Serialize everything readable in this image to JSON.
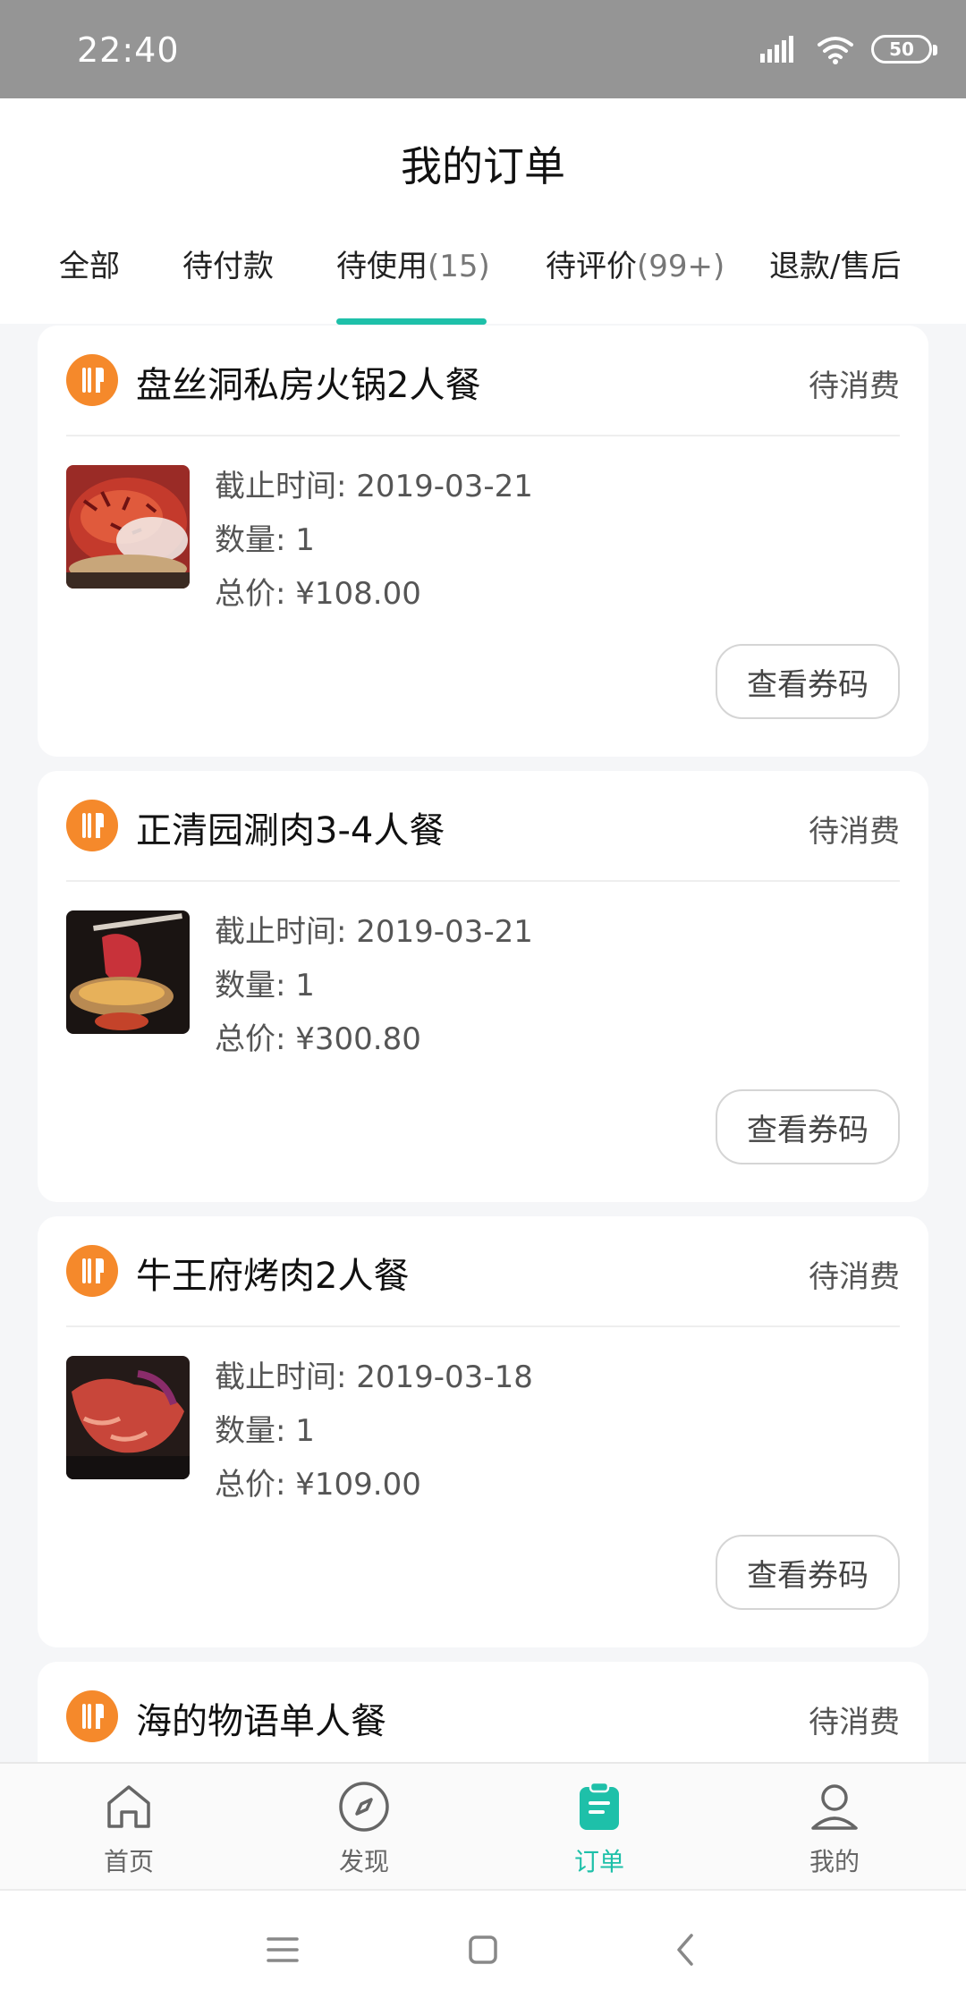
{
  "status_bar": {
    "time": "22:40",
    "battery": "50"
  },
  "header": {
    "title": "我的订单"
  },
  "tabs": [
    {
      "label": "全部",
      "count": ""
    },
    {
      "label": "待付款",
      "count": ""
    },
    {
      "label": "待使用",
      "count": "(15)"
    },
    {
      "label": "待评价",
      "count": "(99+)"
    },
    {
      "label": "退款/售后",
      "count": ""
    }
  ],
  "active_tab_index": 2,
  "orders": [
    {
      "shop": "盘丝洞私房火锅2人餐",
      "status": "待消费",
      "deadline_label": "截止时间: ",
      "deadline": "2019-03-21",
      "qty_label": "数量: ",
      "qty": "1",
      "total_label": "总价: ",
      "total": "¥108.00",
      "button": "查看券码"
    },
    {
      "shop": "正清园涮肉3-4人餐",
      "status": "待消费",
      "deadline_label": "截止时间: ",
      "deadline": "2019-03-21",
      "qty_label": "数量: ",
      "qty": "1",
      "total_label": "总价: ",
      "total": "¥300.80",
      "button": "查看券码"
    },
    {
      "shop": "牛王府烤肉2人餐",
      "status": "待消费",
      "deadline_label": "截止时间: ",
      "deadline": "2019-03-18",
      "qty_label": "数量: ",
      "qty": "1",
      "total_label": "总价: ",
      "total": "¥109.00",
      "button": "查看券码"
    },
    {
      "shop": "海的物语单人餐",
      "status": "待消费"
    }
  ],
  "bottom_nav": [
    {
      "label": "首页",
      "icon": "home-icon"
    },
    {
      "label": "发现",
      "icon": "compass-icon"
    },
    {
      "label": "订单",
      "icon": "clipboard-icon"
    },
    {
      "label": "我的",
      "icon": "user-icon"
    }
  ],
  "active_bottom_index": 2,
  "colors": {
    "accent": "#1ec0a9",
    "badge": "#f5892b",
    "status_bar": "#959595"
  }
}
